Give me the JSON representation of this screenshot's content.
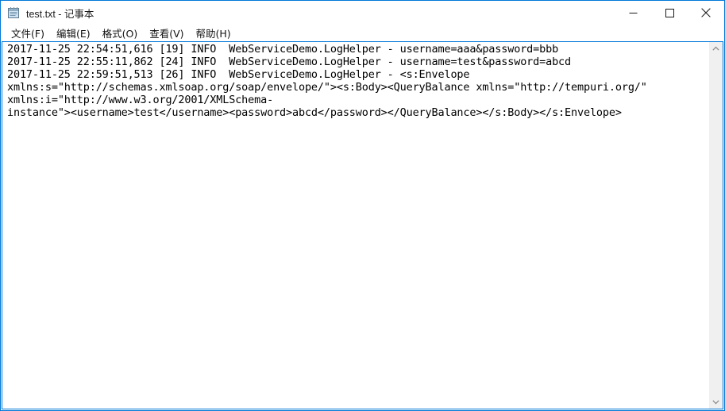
{
  "window": {
    "title": "test.txt - 记事本",
    "app_icon": "notepad-icon",
    "accent_color": "#0078d7",
    "background_color": "#ffffff"
  },
  "titlebar": {
    "minimize_label": "最小化",
    "maximize_label": "最大化",
    "close_label": "关闭"
  },
  "menubar": {
    "items": [
      {
        "label": "文件(F)"
      },
      {
        "label": "编辑(E)"
      },
      {
        "label": "格式(O)"
      },
      {
        "label": "查看(V)"
      },
      {
        "label": "帮助(H)"
      }
    ]
  },
  "editor": {
    "lines": [
      "2017-11-25 22:54:51,616 [19] INFO  WebServiceDemo.LogHelper - username=aaa&password=bbb",
      "2017-11-25 22:55:11,862 [24] INFO  WebServiceDemo.LogHelper - username=test&password=abcd",
      "2017-11-25 22:59:51,513 [26] INFO  WebServiceDemo.LogHelper - <s:Envelope",
      "xmlns:s=\"http://schemas.xmlsoap.org/soap/envelope/\"><s:Body><QueryBalance xmlns=\"http://tempuri.org/\"",
      "xmlns:i=\"http://www.w3.org/2001/XMLSchema-",
      "instance\"><username>test</username><password>abcd</password></QueryBalance></s:Body></s:Envelope>"
    ]
  },
  "scrollbar": {
    "up_arrow": "chevron-up-icon",
    "down_arrow": "chevron-down-icon"
  }
}
